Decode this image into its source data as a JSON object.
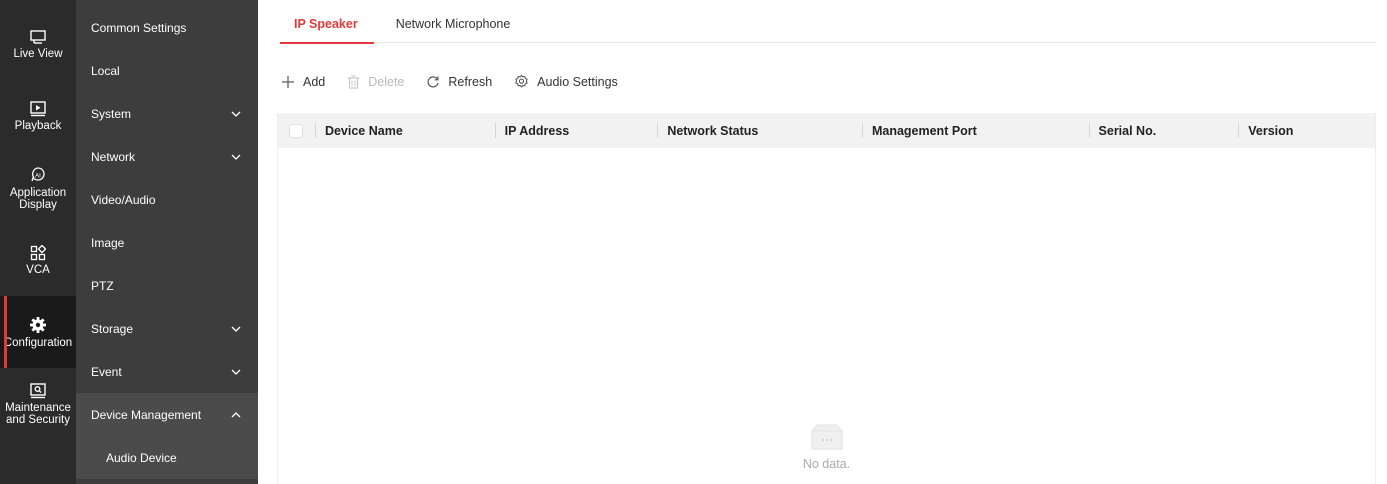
{
  "rail": {
    "items": [
      {
        "label": "Live View",
        "icon": "monitor-icon",
        "active": false
      },
      {
        "label": "Playback",
        "icon": "play-icon",
        "active": false
      },
      {
        "label": "Application Display",
        "icon": "ai-icon",
        "active": false
      },
      {
        "label": "VCA",
        "icon": "grid-icon",
        "active": false
      },
      {
        "label": "Configuration",
        "icon": "gear-icon",
        "active": true
      },
      {
        "label": "Maintenance and Security",
        "icon": "maintenance-icon",
        "active": false
      }
    ]
  },
  "submenu": {
    "items": [
      {
        "label": "Common Settings",
        "chevron": "none"
      },
      {
        "label": "Local",
        "chevron": "none"
      },
      {
        "label": "System",
        "chevron": "down"
      },
      {
        "label": "Network",
        "chevron": "down"
      },
      {
        "label": "Video/Audio",
        "chevron": "none"
      },
      {
        "label": "Image",
        "chevron": "none"
      },
      {
        "label": "PTZ",
        "chevron": "none"
      },
      {
        "label": "Storage",
        "chevron": "down"
      },
      {
        "label": "Event",
        "chevron": "down"
      },
      {
        "label": "Device Management",
        "chevron": "up"
      }
    ],
    "child": "Audio Device"
  },
  "tabs": [
    {
      "label": "IP Speaker",
      "active": true
    },
    {
      "label": "Network Microphone",
      "active": false
    }
  ],
  "toolbar": {
    "add": "Add",
    "delete": "Delete",
    "refresh": "Refresh",
    "audio_settings": "Audio Settings"
  },
  "table": {
    "columns": [
      "Device Name",
      "IP Address",
      "Network Status",
      "Management Port",
      "Serial No.",
      "Version"
    ],
    "rows": [],
    "empty_text": "No data."
  },
  "colors": {
    "accent": "#e4393c",
    "rail_bg": "#2b2b2b",
    "submenu_bg": "#3d3d3d",
    "header_bg": "#f2f2f2"
  }
}
